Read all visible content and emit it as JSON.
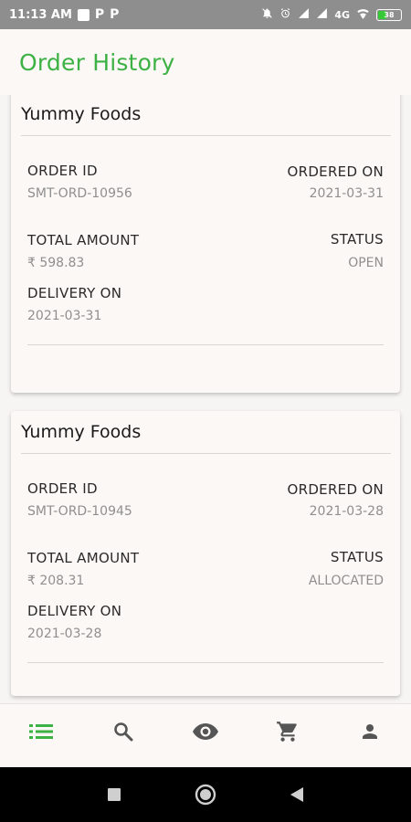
{
  "status_bar": {
    "time": "11:13 AM",
    "network": "4G",
    "battery": "38"
  },
  "header": {
    "title": "Order History"
  },
  "orders": [
    {
      "vendor": "Yummy Foods",
      "order_id_label": "ORDER ID",
      "order_id": "SMT-ORD-10956",
      "ordered_on_label": "ORDERED ON",
      "ordered_on": "2021-03-31",
      "total_amount_label": "TOTAL AMOUNT",
      "total_amount": "₹ 598.83",
      "status_label": "STATUS",
      "status": "OPEN",
      "delivery_on_label": "DELIVERY ON",
      "delivery_on": "2021-03-31"
    },
    {
      "vendor": "Yummy Foods",
      "order_id_label": "ORDER ID",
      "order_id": "SMT-ORD-10945",
      "ordered_on_label": "ORDERED ON",
      "ordered_on": "2021-03-28",
      "total_amount_label": "TOTAL AMOUNT",
      "total_amount": "₹ 208.31",
      "status_label": "STATUS",
      "status": "ALLOCATED",
      "delivery_on_label": "DELIVERY ON",
      "delivery_on": "2021-03-28"
    }
  ],
  "bottom_nav": {
    "items": [
      {
        "icon": "list-icon",
        "active": true
      },
      {
        "icon": "search-icon",
        "active": false
      },
      {
        "icon": "eye-icon",
        "active": false
      },
      {
        "icon": "cart-icon",
        "active": false
      },
      {
        "icon": "person-icon",
        "active": false
      }
    ]
  },
  "colors": {
    "accent": "#3cb144",
    "card_bg": "#fcf8f5",
    "nav_icon": "#555555"
  }
}
